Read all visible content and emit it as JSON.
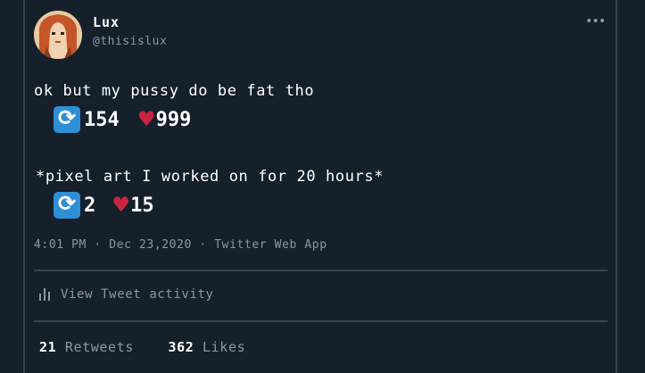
{
  "author": {
    "name": "Lux",
    "handle": "@thisislux"
  },
  "tweet": {
    "text": "ok but my pussy do be fat tho",
    "retweets": "154",
    "likes": "999"
  },
  "caption": {
    "text": "*pixel art I worked on for 20 hours*",
    "retweets": "2",
    "likes": "15"
  },
  "meta": {
    "text": "4:01 PM · Dec 23,2020 · Twitter Web App"
  },
  "activity": {
    "label": "View Tweet activity"
  },
  "counts": {
    "retweets_value": "21",
    "retweets_label": "Retweets",
    "likes_value": "362",
    "likes_label": "Likes"
  },
  "icons": {
    "retweet": "retweet-icon",
    "heart": "heart-icon",
    "more": "more-icon",
    "activity": "bar-chart-icon"
  },
  "colors": {
    "background": "#15202b",
    "muted": "#8899a6",
    "heart": "#c7243f",
    "retweet": "#2e8fd6"
  }
}
